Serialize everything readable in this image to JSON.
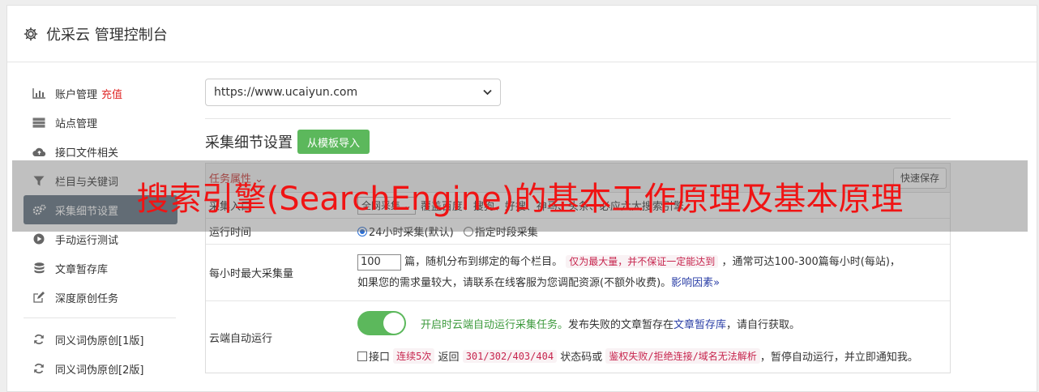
{
  "header": {
    "title": "优采云 管理控制台",
    "icon": "gear-icon"
  },
  "sidebar": {
    "items": [
      {
        "label": "账户管理",
        "tag": "充值",
        "icon": "bar-chart-icon"
      },
      {
        "label": "站点管理",
        "icon": "server-icon"
      },
      {
        "label": "接口文件相关",
        "icon": "cloud-upload-icon"
      },
      {
        "label": "栏目与关键词",
        "icon": "filter-icon"
      },
      {
        "label": "采集细节设置",
        "icon": "gears-icon",
        "active": true
      },
      {
        "label": "手动运行测试",
        "icon": "play-circle-icon"
      },
      {
        "label": "文章暂存库",
        "icon": "database-icon"
      },
      {
        "label": "深度原创任务",
        "icon": "edit-icon"
      },
      {
        "label": "同义词伪原创[1版]",
        "icon": "refresh-icon"
      },
      {
        "label": "同义词伪原创[2版]",
        "icon": "refresh-icon"
      }
    ]
  },
  "main": {
    "site_select": "https://www.ucaiyun.com",
    "section_title": "采集细节设置",
    "import_button": "从模板导入",
    "panel": {
      "title": "任务属性 ⌄",
      "save_button": "快速保存",
      "rows": {
        "source": {
          "label": "采集入口",
          "select": "全网采集",
          "text": "覆盖百度、搜狗、好搜、神马、头条、必应六大搜索引擎"
        },
        "runtime": {
          "label": "运行时间",
          "opt1": "24小时采集(默认)",
          "opt2": "指定时段采集"
        },
        "max": {
          "label": "每小时最大采集量",
          "value": "100",
          "t1": "篇，随机分布到绑定的每个栏目。",
          "code1": "仅为最大量，并不保证一定能达到",
          "t2": "，通常可达100-300篇每小时(每站)，",
          "t3": "如果您的需求量较大，请联系在线客服为您调配资源(不额外收费)。",
          "link": "影响因素»"
        },
        "cloud": {
          "label": "云端自动运行",
          "green": "开启时云端自动运行采集任务。",
          "t1": "发布失败的文章暂存在",
          "link": "文章暂存库",
          "t2": "，请自行获取。",
          "c_label": "接口",
          "c_code1": "连续5次",
          "c_t1": "返回",
          "c_code2": "301/302/403/404",
          "c_t2": "状态码或",
          "c_code3": "鉴权失败/拒绝连接/域名无法解析",
          "c_t3": "，暂停自动运行，并立即通知我。"
        }
      }
    }
  },
  "watermark": "搜索引擎(SearchEngine)的基本工作原理及基本原理",
  "colors": {
    "green": "#5cb85c",
    "active_sidebar": "#5d6f7e",
    "watermark": "#f01414"
  }
}
